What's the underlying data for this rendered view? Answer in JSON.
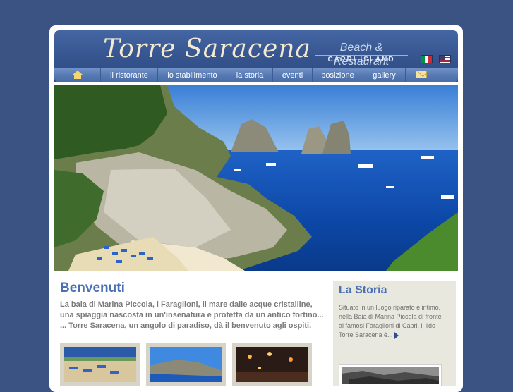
{
  "header": {
    "logo_text": "Torre Saracena",
    "tagline": "Beach & Restaurant",
    "location": "CAPRI ISLAND",
    "languages": [
      "Italiano",
      "English"
    ]
  },
  "nav": {
    "items": [
      {
        "label": "il ristorante"
      },
      {
        "label": "lo stabilimento"
      },
      {
        "label": "la storia"
      },
      {
        "label": "eventi"
      },
      {
        "label": "posizione"
      },
      {
        "label": "gallery"
      }
    ],
    "icons": [
      "home-icon",
      "mail-icon"
    ]
  },
  "welcome": {
    "title": "Benvenuti",
    "lines": [
      "La baia di Marina Piccola, i Faraglioni, il mare dalle acque cristalline,",
      "una spiaggia nascosta in un'insenatura e protetta da un antico fortino...",
      "... Torre Saracena, un angolo di paradiso, dà il benvenuto agli ospiti."
    ]
  },
  "sidebar": {
    "title": "La Storia",
    "lines": [
      "Situato in un luogo riparato e intimo,",
      "nella Baia di Marina Piccola di fronte",
      "ai famosi Faraglioni di Capri, il lido",
      "Torre Saracena è..."
    ]
  },
  "colors": {
    "page_background": "#3b5382",
    "header_blue": "#34528c",
    "nav_blue": "#5577b2",
    "title_blue": "#4a6fb3",
    "sidebar_background": "#e9e8df"
  }
}
